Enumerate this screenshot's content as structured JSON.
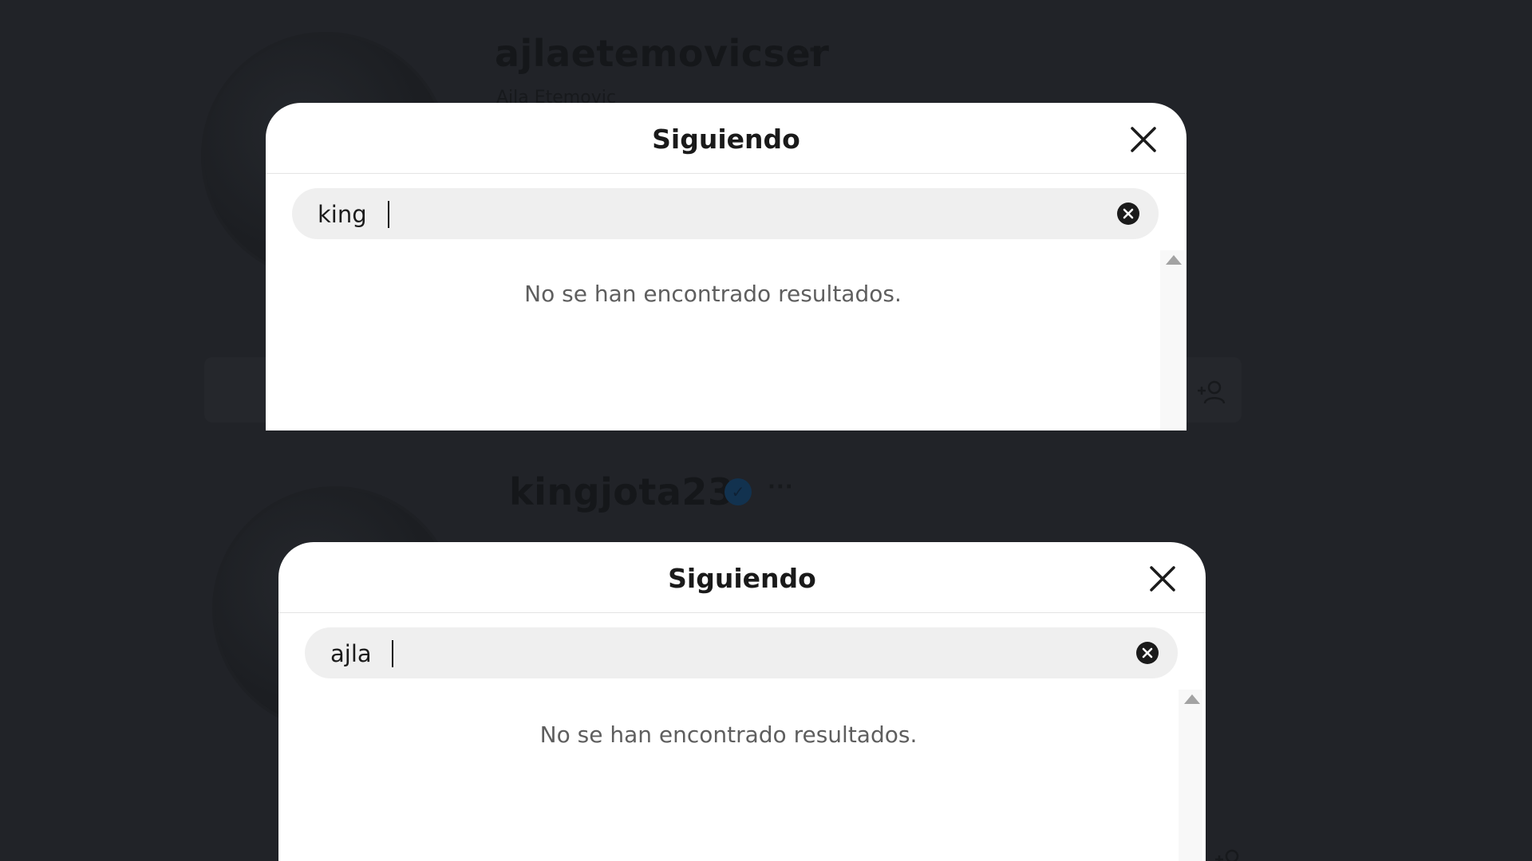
{
  "top_panel": {
    "profile": {
      "username": "ajlaetemovicser",
      "display_name": "Ajla Etemovic",
      "more_label": "···"
    },
    "dialog": {
      "title": "Siguiendo",
      "search": {
        "value": "king"
      },
      "empty_message": "No se han encontrado resultados."
    }
  },
  "bottom_panel": {
    "profile": {
      "username": "kingjota23",
      "verified": true,
      "more_label": "···"
    },
    "dialog": {
      "title": "Siguiendo",
      "search": {
        "value": "ajla"
      },
      "empty_message": "No se han encontrado resultados."
    }
  },
  "icons": {
    "close": "close-icon",
    "clear": "clear-search-icon",
    "scroll": "scroll-up-arrow-icon",
    "follow": "add-person-icon",
    "verified": "verified-badge-icon"
  },
  "colors": {
    "backdrop": "#212328",
    "modal": "#ffffff",
    "search_bg": "#efefef",
    "empty_text": "#5e5e5e"
  }
}
